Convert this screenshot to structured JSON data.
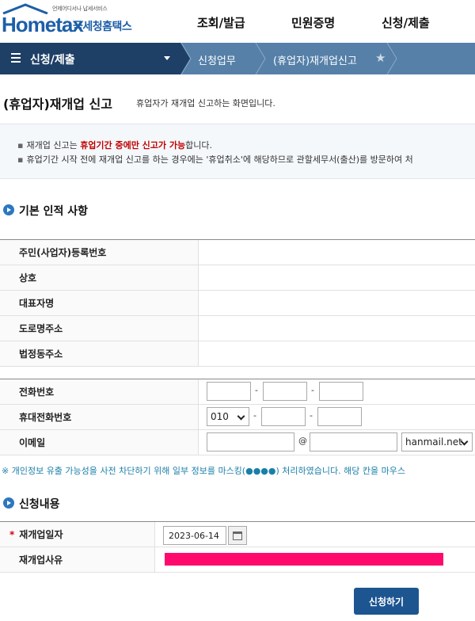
{
  "header": {
    "logo_tagline": "언제어디서나 납세서비스",
    "logo_brand": "Hometax",
    "logo_sub": "국세청홈택스",
    "nav": [
      "조회/발급",
      "민원증명",
      "신청/제출"
    ]
  },
  "breadcrumb": {
    "menu_label": "신청/제출",
    "items": [
      "신청업무",
      "(휴업자)재개업신고"
    ],
    "star_icon": "star-icon"
  },
  "page": {
    "title": "(휴업자)재개업 신고",
    "description": "휴업자가 재개업 신고하는 화면입니다."
  },
  "info": {
    "line1_pre": "재개업 신고는 ",
    "line1_red": "휴업기간 중에만 신고가 가능",
    "line1_post": "합니다.",
    "line2": "휴업기간 시작 전에 재개업 신고를 하는 경우에는 '휴업취소'에 해당하므로 관할세무서(출산)를 방문하여 처"
  },
  "basic": {
    "heading": "기본 인적 사항",
    "labels": [
      "주민(사업자)등록번호",
      "상호",
      "대표자명",
      "도로명주소",
      "법정동주소"
    ]
  },
  "contact": {
    "phone_label": "전화번호",
    "mobile_label": "휴대전화번호",
    "email_label": "이메일",
    "mobile_prefix": "010",
    "dash": "-",
    "at": "@",
    "email_domain": "hanmail.net"
  },
  "notice": "※ 개인정보 유출 가능성을 사전 차단하기 위해 일부 정보를 마스킹(●●●●) 처리하였습니다. 해당 칸을 마우스",
  "apply": {
    "heading": "신청내용",
    "req_mark": "*",
    "date_label": "재개업일자",
    "date_value": "2023-06-14",
    "reason_label": "재개업사유"
  },
  "submit_label": "신청하기",
  "colors": {
    "brand": "#1d5fa8",
    "nav_dark": "#1e3f66",
    "nav_bar": "#5680a8",
    "warning_red": "#c00000",
    "notice": "#1a7fa8",
    "highlight": "#ff0a6c",
    "button": "#1d5591"
  }
}
